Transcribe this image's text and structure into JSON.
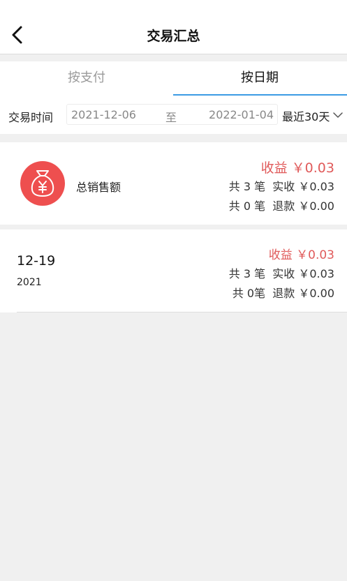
{
  "header": {
    "title": "交易汇总"
  },
  "tabs": [
    {
      "label": "按支付",
      "active": false
    },
    {
      "label": "按日期",
      "active": true
    }
  ],
  "filter": {
    "label": "交易时间",
    "start_date": "2021-12-06",
    "separator": "至",
    "end_date": "2022-01-04",
    "range": "最近30天"
  },
  "summary": {
    "label": "总销售额",
    "profit": "收益 ￥0.03",
    "received": "共 3 笔  实收 ￥0.03",
    "refund": "共 0 笔  退款 ￥0.00"
  },
  "days": [
    {
      "date": "12-19",
      "year": "2021",
      "profit": "收益 ￥0.03",
      "received": "共 3 笔  实收 ￥0.03",
      "refund": "共 0笔  退款 ￥0.00"
    }
  ],
  "colors": {
    "accent": "#3b9be4",
    "profit": "#e05a5a",
    "icon_bg": "#ee4f4f"
  }
}
